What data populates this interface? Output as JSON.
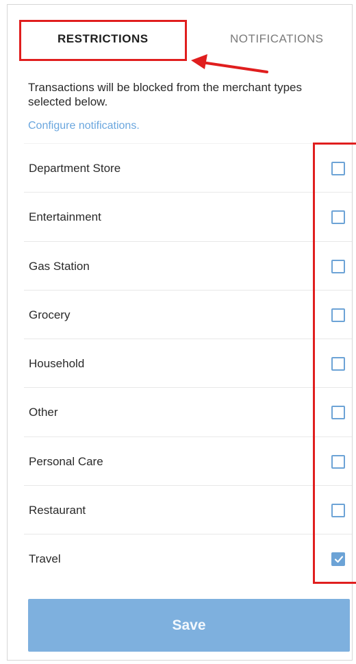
{
  "tabs": [
    {
      "label": "RESTRICTIONS",
      "active": true
    },
    {
      "label": "NOTIFICATIONS",
      "active": false
    }
  ],
  "description": "Transactions will be blocked from the merchant types selected below.",
  "configure_link": "Configure notifications.",
  "merchant_types": [
    {
      "label": "Department Store",
      "checked": false
    },
    {
      "label": "Entertainment",
      "checked": false
    },
    {
      "label": "Gas Station",
      "checked": false
    },
    {
      "label": "Grocery",
      "checked": false
    },
    {
      "label": "Household",
      "checked": false
    },
    {
      "label": "Other",
      "checked": false
    },
    {
      "label": "Personal Care",
      "checked": false
    },
    {
      "label": "Restaurant",
      "checked": false
    },
    {
      "label": "Travel",
      "checked": true
    }
  ],
  "save_label": "Save",
  "colors": {
    "accent": "#6ca3d6",
    "link": "#6aa6de",
    "save_button": "#7eb0de",
    "annotation": "#e01e1e"
  },
  "icons": {
    "checkbox_checked": "check-icon",
    "annotation_arrow": "arrow-left-icon"
  }
}
